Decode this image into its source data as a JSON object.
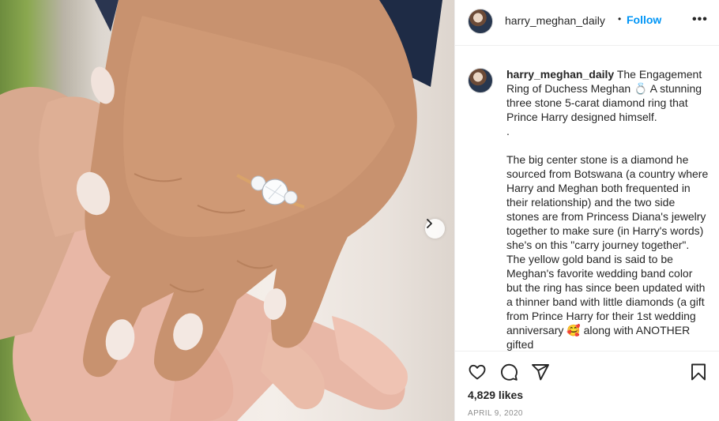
{
  "header": {
    "username": "harry_meghan_daily",
    "separator": "•",
    "follow_label": "Follow",
    "more_icon": "more-options-icon",
    "more_label": "•••"
  },
  "media": {
    "description_icon": "ring-photo",
    "next_icon": "chevron-right-icon"
  },
  "caption": {
    "username": "harry_meghan_daily",
    "line1": "The Engagement Ring of Duchess Meghan 💍 A stunning three stone 5-carat diamond ring that Prince Harry designed himself.",
    "line2": ".",
    "line3": "The big center stone is a diamond he sourced from Botswana (a country where Harry and Meghan both frequented in their relationship) and the two side stones are from Princess Diana's jewelry together to make sure (in Harry's words) she's on this \"carry journey together\". The yellow gold band is said to be Meghan's favorite wedding band color but the ring has since been updated with a thinner band with little diamonds (a gift from Prince Harry for their 1st wedding anniversary 🥰 along with ANOTHER gifted"
  },
  "actions": {
    "like_icon": "heart-icon",
    "comment_icon": "comment-icon",
    "share_icon": "share-icon",
    "save_icon": "bookmark-icon",
    "likes": "4,829 likes",
    "date": "APRIL 9, 2020"
  }
}
